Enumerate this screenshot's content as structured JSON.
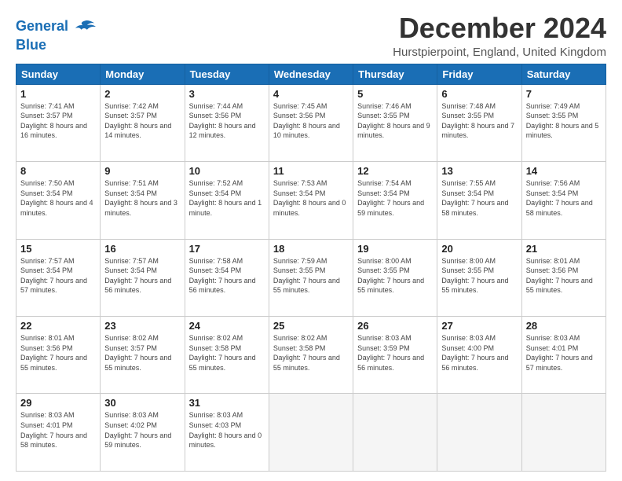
{
  "header": {
    "logo_line1": "General",
    "logo_line2": "Blue",
    "month_title": "December 2024",
    "subtitle": "Hurstpierpoint, England, United Kingdom"
  },
  "days_of_week": [
    "Sunday",
    "Monday",
    "Tuesday",
    "Wednesday",
    "Thursday",
    "Friday",
    "Saturday"
  ],
  "weeks": [
    [
      {
        "day": "1",
        "sunrise": "7:41 AM",
        "sunset": "3:57 PM",
        "daylight": "8 hours and 16 minutes."
      },
      {
        "day": "2",
        "sunrise": "7:42 AM",
        "sunset": "3:57 PM",
        "daylight": "8 hours and 14 minutes."
      },
      {
        "day": "3",
        "sunrise": "7:44 AM",
        "sunset": "3:56 PM",
        "daylight": "8 hours and 12 minutes."
      },
      {
        "day": "4",
        "sunrise": "7:45 AM",
        "sunset": "3:56 PM",
        "daylight": "8 hours and 10 minutes."
      },
      {
        "day": "5",
        "sunrise": "7:46 AM",
        "sunset": "3:55 PM",
        "daylight": "8 hours and 9 minutes."
      },
      {
        "day": "6",
        "sunrise": "7:48 AM",
        "sunset": "3:55 PM",
        "daylight": "8 hours and 7 minutes."
      },
      {
        "day": "7",
        "sunrise": "7:49 AM",
        "sunset": "3:55 PM",
        "daylight": "8 hours and 5 minutes."
      }
    ],
    [
      {
        "day": "8",
        "sunrise": "7:50 AM",
        "sunset": "3:54 PM",
        "daylight": "8 hours and 4 minutes."
      },
      {
        "day": "9",
        "sunrise": "7:51 AM",
        "sunset": "3:54 PM",
        "daylight": "8 hours and 3 minutes."
      },
      {
        "day": "10",
        "sunrise": "7:52 AM",
        "sunset": "3:54 PM",
        "daylight": "8 hours and 1 minute."
      },
      {
        "day": "11",
        "sunrise": "7:53 AM",
        "sunset": "3:54 PM",
        "daylight": "8 hours and 0 minutes."
      },
      {
        "day": "12",
        "sunrise": "7:54 AM",
        "sunset": "3:54 PM",
        "daylight": "7 hours and 59 minutes."
      },
      {
        "day": "13",
        "sunrise": "7:55 AM",
        "sunset": "3:54 PM",
        "daylight": "7 hours and 58 minutes."
      },
      {
        "day": "14",
        "sunrise": "7:56 AM",
        "sunset": "3:54 PM",
        "daylight": "7 hours and 58 minutes."
      }
    ],
    [
      {
        "day": "15",
        "sunrise": "7:57 AM",
        "sunset": "3:54 PM",
        "daylight": "7 hours and 57 minutes."
      },
      {
        "day": "16",
        "sunrise": "7:57 AM",
        "sunset": "3:54 PM",
        "daylight": "7 hours and 56 minutes."
      },
      {
        "day": "17",
        "sunrise": "7:58 AM",
        "sunset": "3:54 PM",
        "daylight": "7 hours and 56 minutes."
      },
      {
        "day": "18",
        "sunrise": "7:59 AM",
        "sunset": "3:55 PM",
        "daylight": "7 hours and 55 minutes."
      },
      {
        "day": "19",
        "sunrise": "8:00 AM",
        "sunset": "3:55 PM",
        "daylight": "7 hours and 55 minutes."
      },
      {
        "day": "20",
        "sunrise": "8:00 AM",
        "sunset": "3:55 PM",
        "daylight": "7 hours and 55 minutes."
      },
      {
        "day": "21",
        "sunrise": "8:01 AM",
        "sunset": "3:56 PM",
        "daylight": "7 hours and 55 minutes."
      }
    ],
    [
      {
        "day": "22",
        "sunrise": "8:01 AM",
        "sunset": "3:56 PM",
        "daylight": "7 hours and 55 minutes."
      },
      {
        "day": "23",
        "sunrise": "8:02 AM",
        "sunset": "3:57 PM",
        "daylight": "7 hours and 55 minutes."
      },
      {
        "day": "24",
        "sunrise": "8:02 AM",
        "sunset": "3:58 PM",
        "daylight": "7 hours and 55 minutes."
      },
      {
        "day": "25",
        "sunrise": "8:02 AM",
        "sunset": "3:58 PM",
        "daylight": "7 hours and 55 minutes."
      },
      {
        "day": "26",
        "sunrise": "8:03 AM",
        "sunset": "3:59 PM",
        "daylight": "7 hours and 56 minutes."
      },
      {
        "day": "27",
        "sunrise": "8:03 AM",
        "sunset": "4:00 PM",
        "daylight": "7 hours and 56 minutes."
      },
      {
        "day": "28",
        "sunrise": "8:03 AM",
        "sunset": "4:01 PM",
        "daylight": "7 hours and 57 minutes."
      }
    ],
    [
      {
        "day": "29",
        "sunrise": "8:03 AM",
        "sunset": "4:01 PM",
        "daylight": "7 hours and 58 minutes."
      },
      {
        "day": "30",
        "sunrise": "8:03 AM",
        "sunset": "4:02 PM",
        "daylight": "7 hours and 59 minutes."
      },
      {
        "day": "31",
        "sunrise": "8:03 AM",
        "sunset": "4:03 PM",
        "daylight": "8 hours and 0 minutes."
      },
      null,
      null,
      null,
      null
    ]
  ]
}
